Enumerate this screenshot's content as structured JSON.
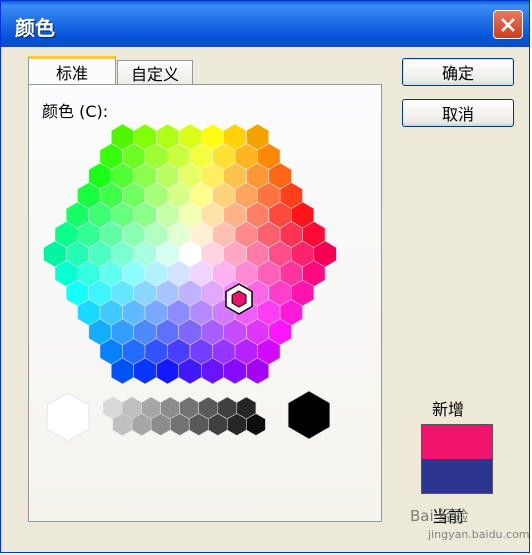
{
  "window": {
    "title": "颜色",
    "close_icon": "close-icon"
  },
  "tabs": [
    {
      "label": "标准",
      "active": true
    },
    {
      "label": "自定义",
      "active": false
    }
  ],
  "colors_label": "颜色 (C):",
  "buttons": {
    "ok": "确定",
    "cancel": "取消"
  },
  "preview": {
    "new_label": "新增",
    "current_label": "当前",
    "new_color": "#f0146c",
    "current_color": "#2c3590"
  },
  "selected_color": "#e8146e",
  "watermark": {
    "text": "Bai 经验",
    "url": "jingyan.baidu.com"
  }
}
